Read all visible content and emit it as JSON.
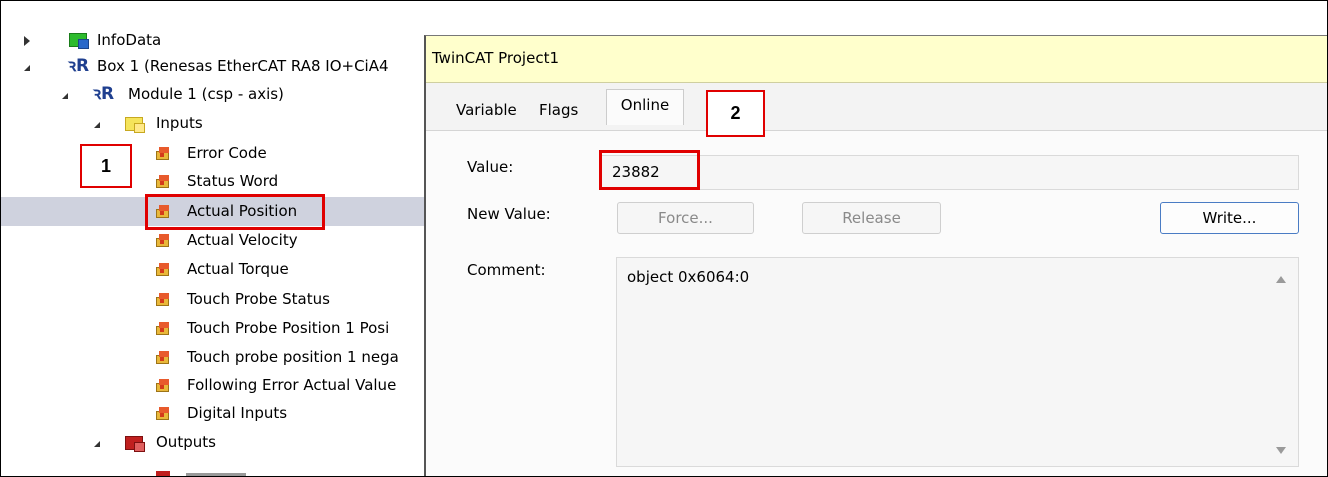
{
  "tree": {
    "items": [
      {
        "label": "InfoData",
        "icon": "folder-green-icon"
      },
      {
        "label": "Box 1 (Renesas EtherCAT RA8 IO+CiA4",
        "icon": "renesas-device-icon"
      },
      {
        "label": "Module 1 (csp - axis)",
        "icon": "renesas-device-icon"
      },
      {
        "label": "Inputs",
        "icon": "folder-yellow-icon"
      },
      {
        "label": "Error Code",
        "icon": "variable-input-icon"
      },
      {
        "label": "Status Word",
        "icon": "variable-input-icon"
      },
      {
        "label": "Actual Position",
        "icon": "variable-input-icon"
      },
      {
        "label": "Actual Velocity",
        "icon": "variable-input-icon"
      },
      {
        "label": "Actual Torque",
        "icon": "variable-input-icon"
      },
      {
        "label": "Touch Probe Status",
        "icon": "variable-input-icon"
      },
      {
        "label": "Touch Probe Position 1 Posi",
        "icon": "variable-input-icon"
      },
      {
        "label": "Touch probe position 1 nega",
        "icon": "variable-input-icon"
      },
      {
        "label": "Following Error Actual Value",
        "icon": "variable-input-icon"
      },
      {
        "label": "Digital Inputs",
        "icon": "variable-input-icon"
      },
      {
        "label": "Outputs",
        "icon": "folder-red-icon"
      }
    ],
    "selected": "Actual Position"
  },
  "annotations": {
    "badge1": "1",
    "badge2": "2",
    "color": "#e00000"
  },
  "dialog": {
    "title": "TwinCAT Project1",
    "tabs": [
      "Variable",
      "Flags",
      "Online"
    ],
    "active_tab": "Online",
    "value_label": "Value:",
    "value": "23882",
    "new_value_label": "New Value:",
    "force_button": "Force...",
    "release_button": "Release",
    "write_button": "Write...",
    "comment_label": "Comment:",
    "comment": "object 0x6064:0"
  },
  "colors": {
    "title_bar": "#ffffcc",
    "selection": "#cfd2de",
    "write_border": "#4a7cc4"
  }
}
